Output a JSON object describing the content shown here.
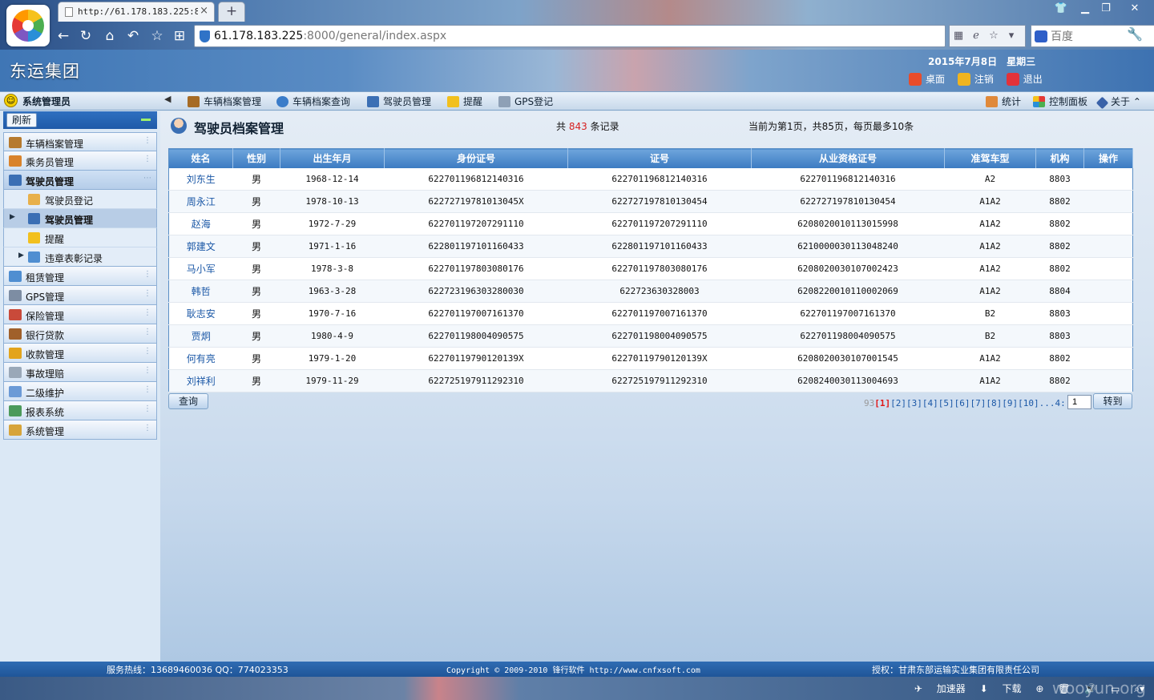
{
  "browser": {
    "tab_title": "http://61.178.183.225:800",
    "url_host": "61.178.183.225",
    "url_rest": ":8000/general/index.aspx",
    "search_placeholder": "百度",
    "window_controls": [
      "shirt-icon",
      "minimize-icon",
      "restore-icon",
      "close-icon"
    ]
  },
  "header": {
    "app_title": "东运集团",
    "date": "2015年7月8日　星期三",
    "links": [
      {
        "label": "桌面",
        "icon": "desktop-icon",
        "color": "#e84c2b"
      },
      {
        "label": "注销",
        "icon": "logout-icon",
        "color": "#f0b41f"
      },
      {
        "label": "退出",
        "icon": "exit-icon",
        "color": "#e2323a"
      }
    ]
  },
  "toolbar": {
    "user": "系统管理员",
    "items": [
      {
        "label": "车辆档案管理",
        "icon": "truck-icon"
      },
      {
        "label": "车辆档案查询",
        "icon": "search-icon"
      },
      {
        "label": "驾驶员管理",
        "icon": "driver-icon"
      },
      {
        "label": "提醒",
        "icon": "star-icon"
      },
      {
        "label": "GPS登记",
        "icon": "gps-icon"
      }
    ],
    "right_items": [
      {
        "label": "统计",
        "icon": "chart-icon"
      },
      {
        "label": "控制面板",
        "icon": "control-panel-icon"
      },
      {
        "label": "关于",
        "icon": "about-icon"
      }
    ]
  },
  "sidebar": {
    "refresh_label": "刷新",
    "menu_top": [
      {
        "label": "车辆档案管理",
        "icon": "truck-icon",
        "color": "#b67a2e"
      },
      {
        "label": "乘务员管理",
        "icon": "crew-icon",
        "color": "#d9832c"
      },
      {
        "label": "驾驶员管理",
        "icon": "driver-icon",
        "color": "#3b6fb4"
      }
    ],
    "submenu": [
      {
        "label": "驾驶员登记",
        "icon": "register-icon",
        "color": "#e8b04a",
        "caret": ""
      },
      {
        "label": "驾驶员管理",
        "icon": "driver-icon",
        "color": "#3b6fb4",
        "caret": "▶"
      },
      {
        "label": "提醒",
        "icon": "star-icon",
        "color": "#f2c01e",
        "caret": ""
      },
      {
        "label": "违章表彰记录",
        "icon": "record-icon",
        "color": "#4f8ed1",
        "caret": "▶"
      }
    ],
    "menu_bottom": [
      {
        "label": "租赁管理",
        "icon": "lease-icon",
        "color": "#4f8ed1"
      },
      {
        "label": "GPS管理",
        "icon": "gps-icon",
        "color": "#7d8da3"
      },
      {
        "label": "保险管理",
        "icon": "insurance-icon",
        "color": "#c94a3a"
      },
      {
        "label": "银行贷款",
        "icon": "bank-icon",
        "color": "#a0602a"
      },
      {
        "label": "收款管理",
        "icon": "payment-icon",
        "color": "#e3a41c"
      },
      {
        "label": "事故理赔",
        "icon": "accident-icon",
        "color": "#9aa8b8"
      },
      {
        "label": "二级维护",
        "icon": "maintenance-icon",
        "color": "#6b9ad6"
      },
      {
        "label": "报表系统",
        "icon": "report-icon",
        "color": "#4c9a5a"
      },
      {
        "label": "系统管理",
        "icon": "system-icon",
        "color": "#d7a43a"
      }
    ]
  },
  "main": {
    "title": "驾驶员档案管理",
    "count_prefix": "共",
    "count": "843",
    "count_suffix": "条记录",
    "page_info": "当前为第1页，共85页，每页最多10条",
    "columns": [
      "姓名",
      "性别",
      "出生年月",
      "身份证号",
      "证号",
      "从业资格证号",
      "准驾车型",
      "机构",
      "操作"
    ],
    "rows": [
      [
        "刘东生",
        "男",
        "1968-12-14",
        "622701196812140316",
        "622701196812140316",
        "622701196812140316",
        "A2",
        "8803",
        ""
      ],
      [
        "周永江",
        "男",
        "1978-10-13",
        "62272719781013045X",
        "622727197810130454",
        "622727197810130454",
        "A1A2",
        "8802",
        ""
      ],
      [
        "赵海",
        "男",
        "1972-7-29",
        "622701197207291110",
        "622701197207291110",
        "620802001011301599​8",
        "A1A2",
        "8802",
        ""
      ],
      [
        "郭建文",
        "男",
        "1971-1-16",
        "622801197101160433",
        "622801197101160433",
        "621000003011304824​0",
        "A1A2",
        "8802",
        ""
      ],
      [
        "马小军",
        "男",
        "1978-3-8",
        "622701197803080176",
        "622701197803080176",
        "620802003010700242​3",
        "A1A2",
        "8802",
        ""
      ],
      [
        "韩哲",
        "男",
        "1963-3-28",
        "622723196303280030",
        "622723630328003",
        "620822001011000206​9",
        "A1A2",
        "8804",
        ""
      ],
      [
        "耿志安",
        "男",
        "1970-7-16",
        "622701197007161370",
        "622701197007161370",
        "622701197007161370",
        "B2",
        "8803",
        ""
      ],
      [
        "贾炯",
        "男",
        "1980-4-9",
        "622701198004090575",
        "622701198004090575",
        "622701198004090575",
        "B2",
        "8803",
        ""
      ],
      [
        "何有亮",
        "男",
        "1979-1-20",
        "62270119790120139X",
        "62270119790120139X",
        "620802003010700154​5",
        "A1A2",
        "8802",
        ""
      ],
      [
        "刘祥利",
        "男",
        "1979-11-29",
        "622725197911292310",
        "622725197911292310",
        "620824003011300469​3",
        "A1A2",
        "8802",
        ""
      ]
    ],
    "query_label": "查询",
    "pager": {
      "lead": "93",
      "current": "[1]",
      "pages": [
        "[2]",
        "[3]",
        "[4]",
        "[5]",
        "[6]",
        "[7]",
        "[8]",
        "[9]",
        "[10]"
      ],
      "tail": "...4:"
    },
    "page_input_value": "1",
    "goto_label": "转到"
  },
  "footer": {
    "hotline": "服务热线：13689460036 QQ：774023353",
    "copyright": "Copyright © 2009-2010 锋行软件 http://www.cnfxsoft.com",
    "license": "授权：甘肃东部运输实业集团有限责任公司"
  },
  "statusbar": {
    "items": [
      "加速器",
      "下载"
    ],
    "watermark": "wooyun.org"
  }
}
